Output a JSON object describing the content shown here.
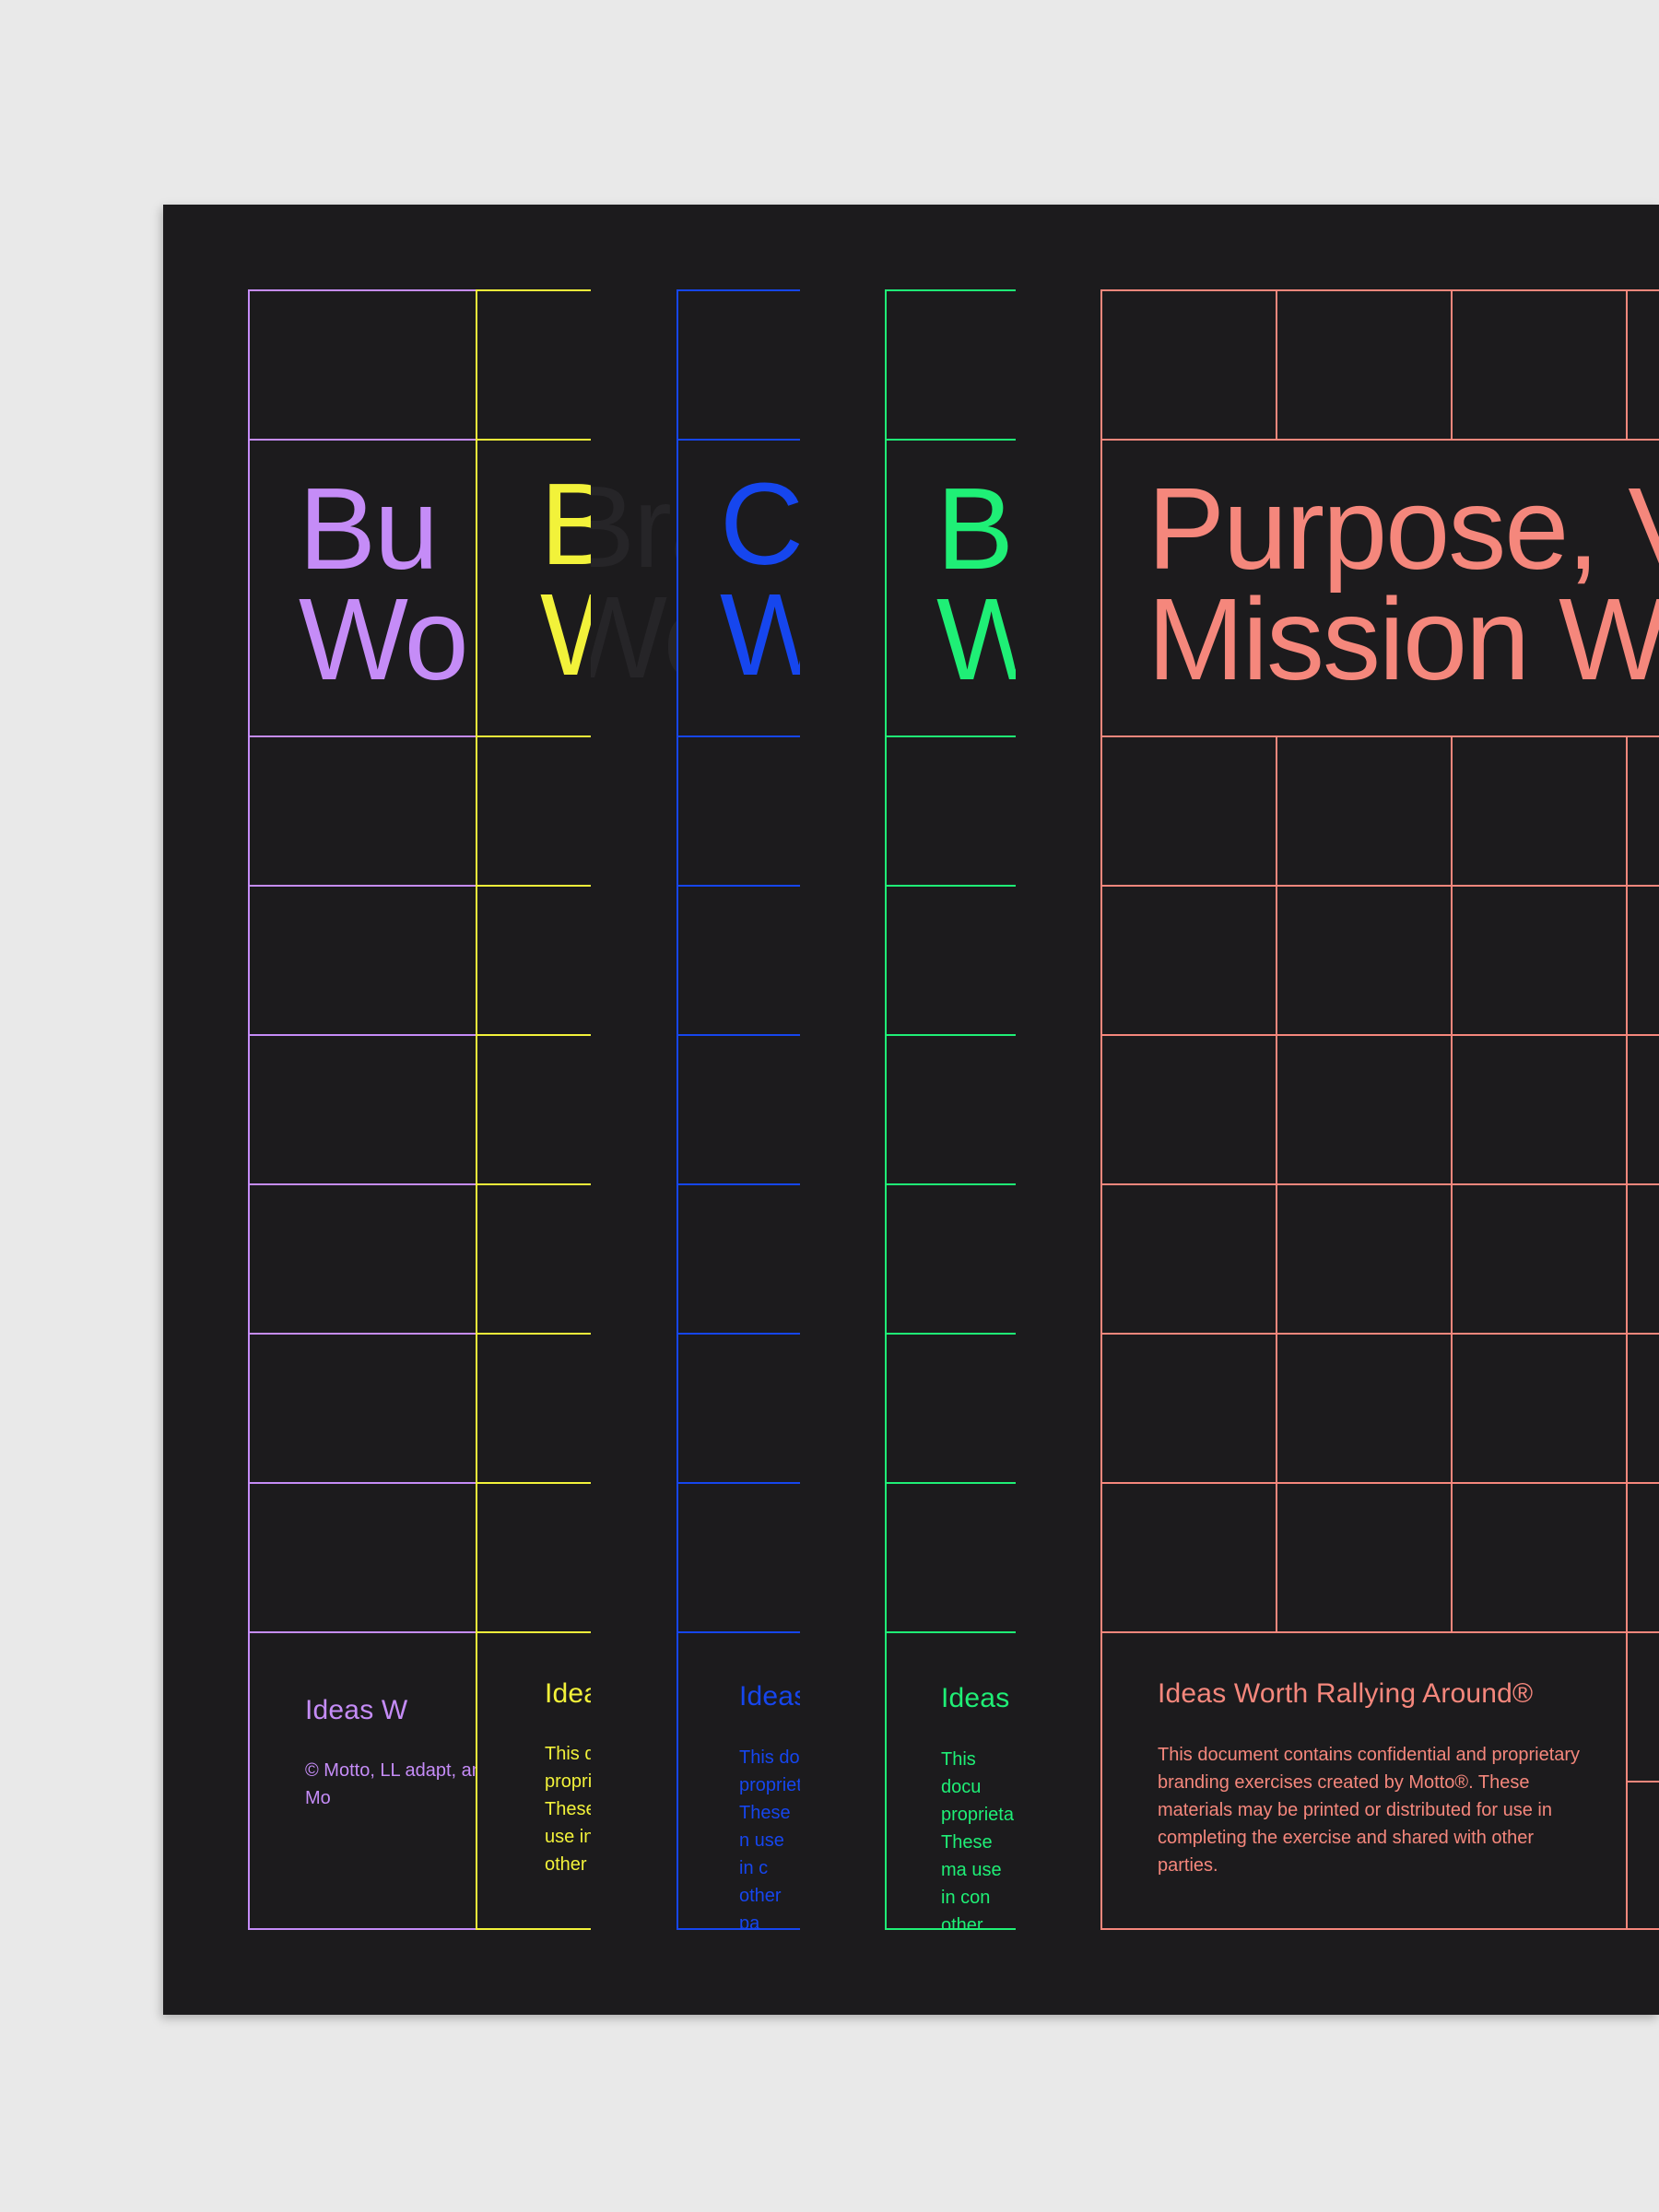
{
  "sheets": [
    {
      "id": "purple",
      "color": "#c58cf7",
      "title_line1": "Bu",
      "title_line2": "Wo",
      "footer_title": "Ideas W",
      "footer_body": "© Motto, LL adapt, and b even comm credit to Mo"
    },
    {
      "id": "yellow",
      "color": "#f2f23a",
      "title_line1": "B",
      "title_line2": "W",
      "footer_title": "Idea",
      "footer_body": "This d propri These use in other"
    },
    {
      "id": "blue",
      "color": "#1646ee",
      "title_line1": "Co",
      "title_line2": "W",
      "footer_title": "Ideas",
      "footer_body": "This do propriet These n use in c other pa"
    },
    {
      "id": "green",
      "color": "#1fef76",
      "title_line1": "Br",
      "title_line2": "W",
      "footer_title": "Ideas",
      "footer_body": "This docu proprieta These ma use in con other par"
    },
    {
      "id": "salmon",
      "color": "#f5877c",
      "title_line1": "Purpose, V",
      "title_line2": "Mission Wo",
      "footer_title": "Ideas Worth Rallying Around®",
      "footer_body": "This document contains confidential and proprietary branding exercises created by Motto®. These materials may be printed or distributed for use in completing the exercise and shared with other parties."
    }
  ],
  "ghost_text": {
    "line1": "Bra",
    "line2": "Wo"
  }
}
